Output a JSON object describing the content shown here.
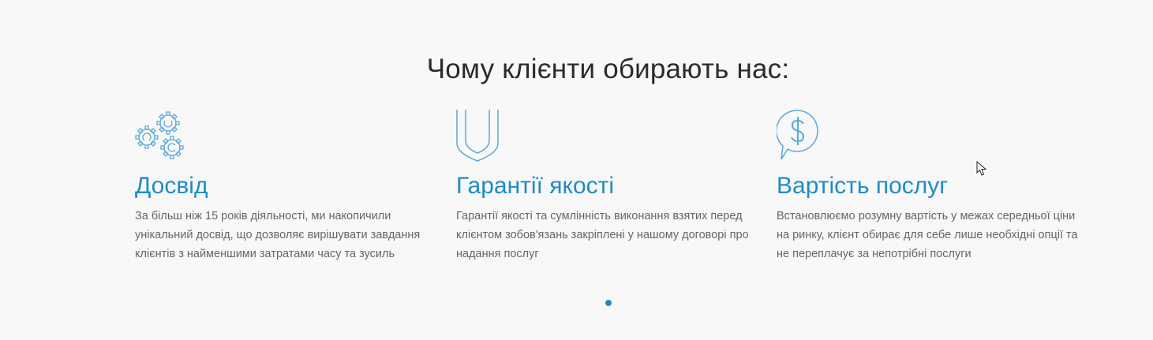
{
  "section": {
    "title": "Чому клієнти обирають нас:"
  },
  "features": [
    {
      "icon": "gears-icon",
      "title": "Досвід",
      "description": "За більш ніж 15 років діяльності, ми накопичили унікальний досвід, що дозволяє вирішувати завдання клієнтів з найменшими затратами часу та зусиль"
    },
    {
      "icon": "shield-icon",
      "title": "Гарантії якості",
      "description": "Гарантії якості та сумлінність виконання взятих перед клієнтом зобов'язань закріплені у нашому договорі про надання послуг"
    },
    {
      "icon": "dollar-speech-bubble-icon",
      "title": "Вартість послуг",
      "description": "Встановлюємо розумну вартість у межах середньої ціни на ринку, клієнт обирає для себе лише необхідні опції та не переплачує за непотрібні послуги"
    }
  ],
  "carousel": {
    "dot_count": 1,
    "active_index": 0
  },
  "colors": {
    "accent": "#1f8bc4",
    "icon": "#5aa9d6",
    "title_text": "#2b2b2b",
    "body_text": "#666666",
    "background": "#f8f8f8"
  }
}
